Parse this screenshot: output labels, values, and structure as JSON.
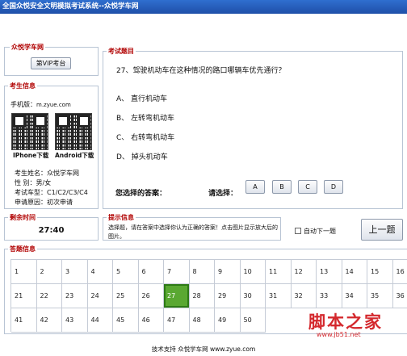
{
  "window": {
    "title": "全国众悦安全文明模拟考试系统--众悦学车网"
  },
  "school": {
    "legend": "众悦学车网",
    "seat_label": "第VIP考台"
  },
  "examinee": {
    "legend": "考生信息",
    "phone_label": "手机版：",
    "phone_url": "m.zyue.com",
    "iphone_label": "IPhone下载",
    "android_label": "Android下载",
    "rows": [
      {
        "label": "考生姓名：",
        "value": "众悦学车网"
      },
      {
        "label": "性    别：",
        "value": "男/女"
      },
      {
        "label": "考试车型：",
        "value": "C1/C2/C3/C4"
      },
      {
        "label": "申请原因：",
        "value": "初次申请"
      }
    ]
  },
  "question": {
    "legend": "考试题目",
    "text": "27、驾驶机动车在这种情况的路口哪辆车优先通行？",
    "options": [
      "A、 直行机动车",
      "B、 左转弯机动车",
      "C、 右转弯机动车",
      "D、 掉头机动车"
    ],
    "your_answer_label": "您选择的答案：",
    "choose_label": "请选择：",
    "answer_buttons": [
      "A",
      "B",
      "C",
      "D"
    ]
  },
  "timer": {
    "legend": "剩余时间",
    "value": "27:40"
  },
  "hint": {
    "legend": "提示信息",
    "text": "选择题，请在答案中选择你认为正确的答案！点击图片显示放大后的图片。"
  },
  "auto_next": {
    "label": "自动下一题",
    "checked": false
  },
  "prev_button": {
    "label": "上一题"
  },
  "answer_sheet": {
    "legend": "答题信息",
    "rows": [
      [
        "1",
        "2",
        "3",
        "4",
        "5",
        "6",
        "7",
        "8",
        "9",
        "10",
        "11",
        "12",
        "13",
        "14",
        "15",
        "16"
      ],
      [
        "21",
        "22",
        "23",
        "24",
        "25",
        "26",
        "27",
        "28",
        "29",
        "30",
        "31",
        "32",
        "33",
        "34",
        "35",
        "36"
      ],
      [
        "41",
        "42",
        "43",
        "44",
        "45",
        "46",
        "47",
        "48",
        "49",
        "50"
      ]
    ],
    "current": "27",
    "current_color": "#5aa832"
  },
  "footer": {
    "text": "技术支持  众悦学车网  www.zyue.com"
  },
  "watermark": {
    "text": "脚本之家",
    "url": "www.jb51.net"
  }
}
